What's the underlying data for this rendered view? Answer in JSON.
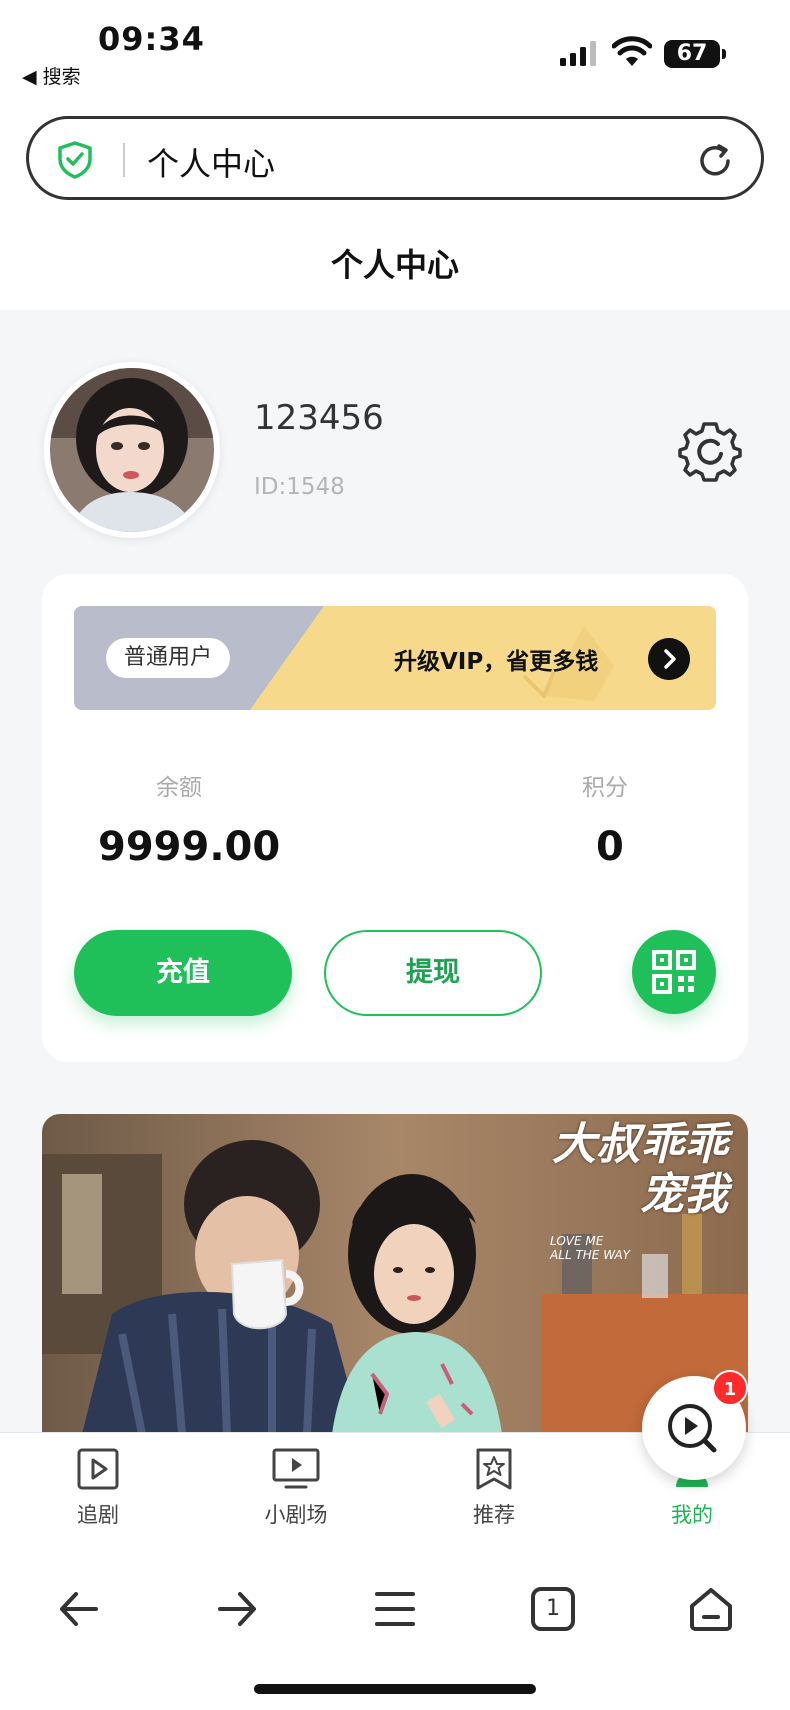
{
  "status_bar": {
    "time": "09:34",
    "back_label": "◀ 搜索",
    "battery": "67"
  },
  "url_bar": {
    "text": "个人中心"
  },
  "page": {
    "title": "个人中心"
  },
  "profile": {
    "username": "123456",
    "id": "ID:1548"
  },
  "wallet": {
    "level": "普通用户",
    "vip_cta": "升级VIP，省更多钱",
    "balance_label": "余额",
    "balance_value": "9999.00",
    "points_label": "积分",
    "points_value": "0",
    "recharge_label": "充值",
    "withdraw_label": "提现"
  },
  "promo": {
    "title_line1": "大叔乖乖",
    "title_line2": "宠我",
    "subtitle_line1": "LOVE ME",
    "subtitle_line2": "ALL THE WAY"
  },
  "floating": {
    "badge": "1"
  },
  "tabs": [
    {
      "label": "追剧",
      "icon": "play-square-icon",
      "active": false
    },
    {
      "label": "小剧场",
      "icon": "tv-icon",
      "active": false
    },
    {
      "label": "推荐",
      "icon": "star-bookmark-icon",
      "active": false
    },
    {
      "label": "我的",
      "icon": "user-icon",
      "active": true
    }
  ],
  "browser": {
    "tab_count": "1"
  },
  "colors": {
    "accent": "#1fc05a",
    "vip_gold": "#f5d98a",
    "badge_red": "#ff2a2a"
  }
}
